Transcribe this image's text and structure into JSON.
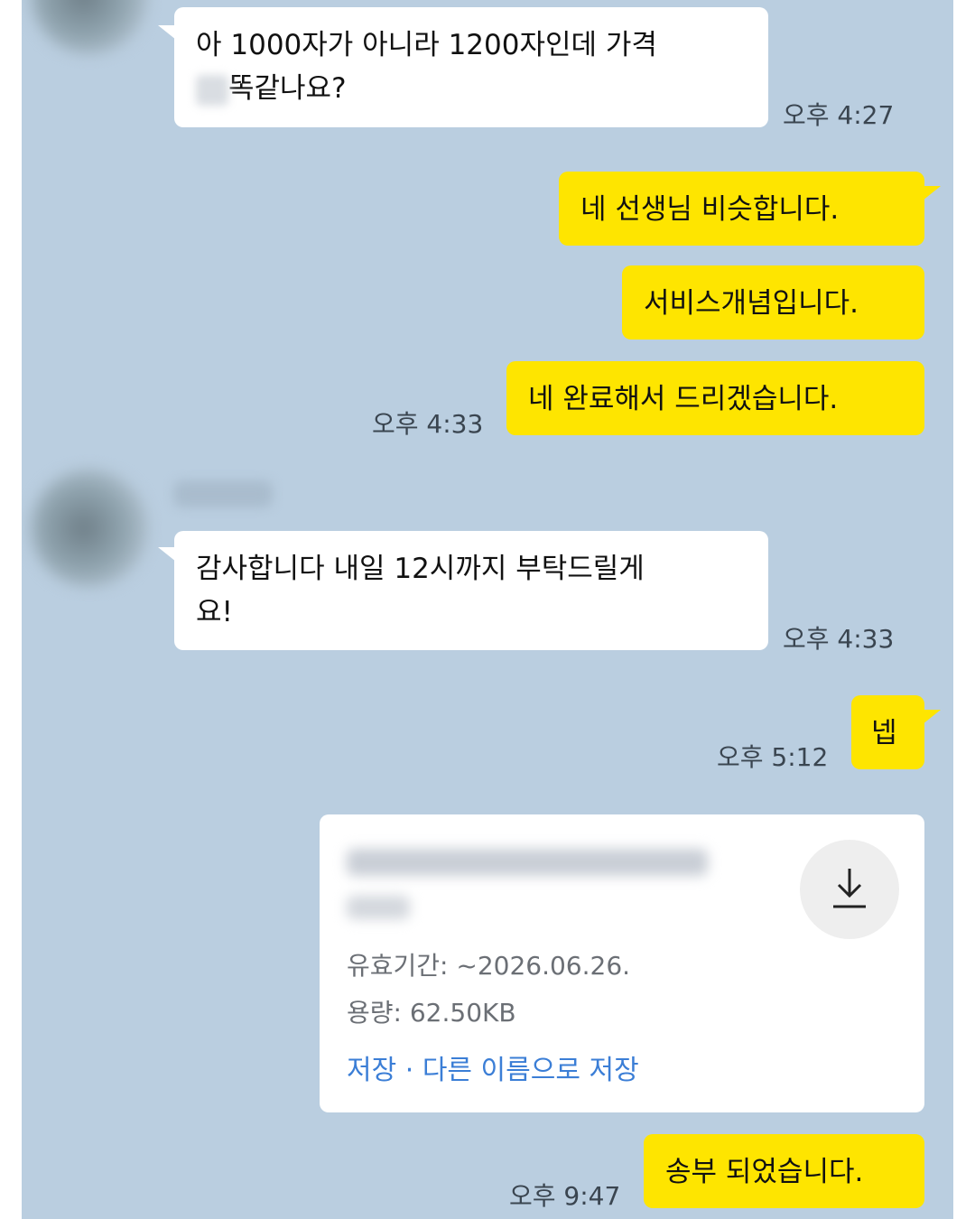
{
  "messages": [
    {
      "id": "m1",
      "side": "in",
      "lines": [
        "아 1000자가 아니라 1200자인데 가격",
        "똑같나요?"
      ],
      "time": "오후 4:27"
    },
    {
      "id": "m2",
      "side": "out",
      "text": "네 선생님 비슷합니다."
    },
    {
      "id": "m3",
      "side": "out",
      "text": "서비스개념입니다."
    },
    {
      "id": "m4",
      "side": "out",
      "text": "네 완료해서 드리겠습니다.",
      "time": "오후 4:33"
    },
    {
      "id": "m5",
      "side": "in",
      "lines": [
        "감사합니다 내일 12시까지 부탁드릴게",
        "요!"
      ],
      "time": "오후 4:33"
    },
    {
      "id": "m6",
      "side": "out",
      "text": "넵",
      "time": "오후 5:12"
    },
    {
      "id": "m7",
      "side": "out",
      "text": "송부 되었습니다.",
      "time": "오후 9:47"
    }
  ],
  "file_card": {
    "validity": "유효기간: ~2026.06.26.",
    "size": "용량: 62.50KB",
    "save_label": "저장",
    "separator": " · ",
    "save_as_label": "다른 이름으로 저장",
    "download_icon": "download-icon"
  },
  "colors": {
    "chat_background": "#bacee0",
    "incoming_bubble": "#ffffff",
    "outgoing_bubble": "#fee500",
    "link": "#3b7ed6"
  }
}
